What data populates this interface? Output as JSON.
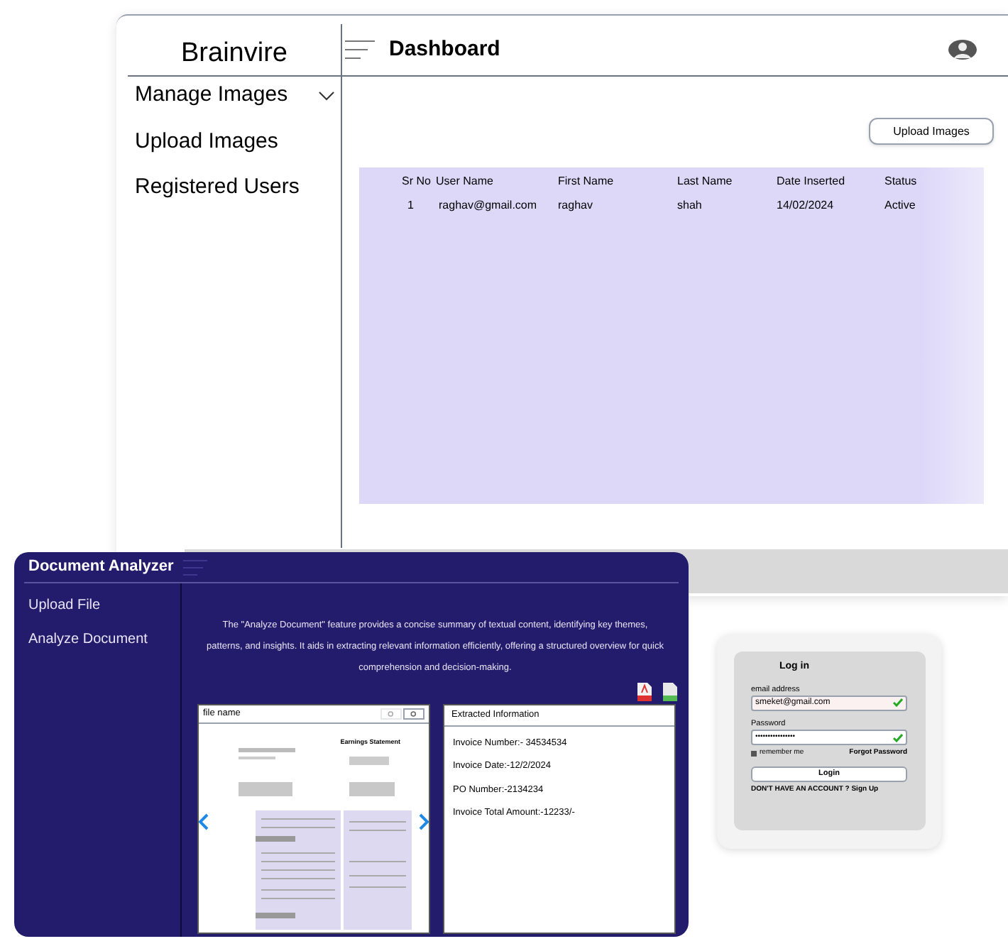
{
  "dashboard": {
    "brand": "Brainvire",
    "title": "Dashboard",
    "sidebar": [
      {
        "label": "Manage Images",
        "expandable": true
      },
      {
        "label": "Upload Images",
        "expandable": false
      },
      {
        "label": "Registered Users",
        "expandable": false
      }
    ],
    "upload_button": "Upload Images",
    "table": {
      "columns": [
        "Sr No",
        "User Name",
        "First Name",
        "Last Name",
        "Date Inserted",
        "Status"
      ],
      "rows": [
        [
          "1",
          "raghav@gmail.com",
          "raghav",
          "shah",
          "14/02/2024",
          "Active"
        ]
      ]
    }
  },
  "analyzer": {
    "title": "Document Analyzer",
    "sidebar": [
      "Upload File",
      "Analyze Document"
    ],
    "description": "The \"Analyze Document\" feature provides a concise summary of textual content, identifying key themes, patterns, and insights. It aids in extracting relevant information efficiently, offering a structured overview for quick comprehension and decision-making.",
    "viewer": {
      "file_name": "file name",
      "document_heading": "Earnings Statement"
    },
    "extracted": {
      "title": "Extracted Information",
      "items": [
        "Invoice Number:- 34534534",
        "Invoice Date:-12/2/2024",
        "PO Number:-2134234",
        "Invoice Total Amount:-12233/-"
      ]
    }
  },
  "login": {
    "title": "Log in",
    "email_label": "email address",
    "email": "smeket@gmail.com",
    "email_valid": true,
    "password_label": "Password",
    "password": "••••••••••••••••",
    "password_valid": true,
    "remember_label": "remember me",
    "remember": true,
    "forgot": "Forgot Password",
    "button": "Login",
    "signup": "DON'T HAVE AN ACCOUNT ? Sign Up"
  }
}
